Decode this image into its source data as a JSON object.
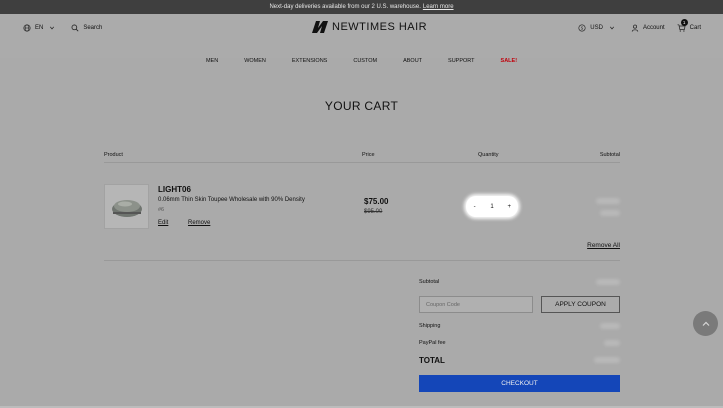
{
  "announcement": {
    "text": "Next-day deliveries available from our 2 U.S. warehouse.",
    "link": "Learn more"
  },
  "header": {
    "language": "EN",
    "search_label": "Search",
    "logo_text": "NEWTIMES HAIR",
    "currency": "USD",
    "account_label": "Account",
    "cart_label": "Cart",
    "cart_count": "1"
  },
  "nav": {
    "men": "MEN",
    "women": "WOMEN",
    "extensions": "EXTENSIONS",
    "custom": "CUSTOM",
    "about": "ABOUT",
    "support": "SUPPORT",
    "sale": "SALE!"
  },
  "cart": {
    "title": "YOUR CART",
    "columns": {
      "product": "Product",
      "price": "Price",
      "quantity": "Quantity",
      "subtotal": "Subtotal"
    },
    "item": {
      "name": "LIGHT06",
      "description": "0.06mm Thin Skin Toupee Wholesale with 90% Density",
      "variant": "#6",
      "edit": "Edit",
      "remove": "Remove",
      "price": "$75.00",
      "original_price": "$95.00",
      "quantity": "1",
      "minus": "-",
      "plus": "+"
    },
    "remove_all": "Remove All"
  },
  "summary": {
    "subtotal_label": "Subtotal",
    "coupon_placeholder": "Coupon Code",
    "apply_coupon": "APPLY COUPON",
    "shipping_label": "Shipping",
    "paypal_fee_label": "PayPal fee",
    "total_label": "TOTAL",
    "checkout": "CHECKOUT"
  },
  "colors": {
    "overlay": "#aaaaaa",
    "checkout": "#1446b8",
    "sale": "#c0000b",
    "topbar": "#3f3f3f"
  }
}
